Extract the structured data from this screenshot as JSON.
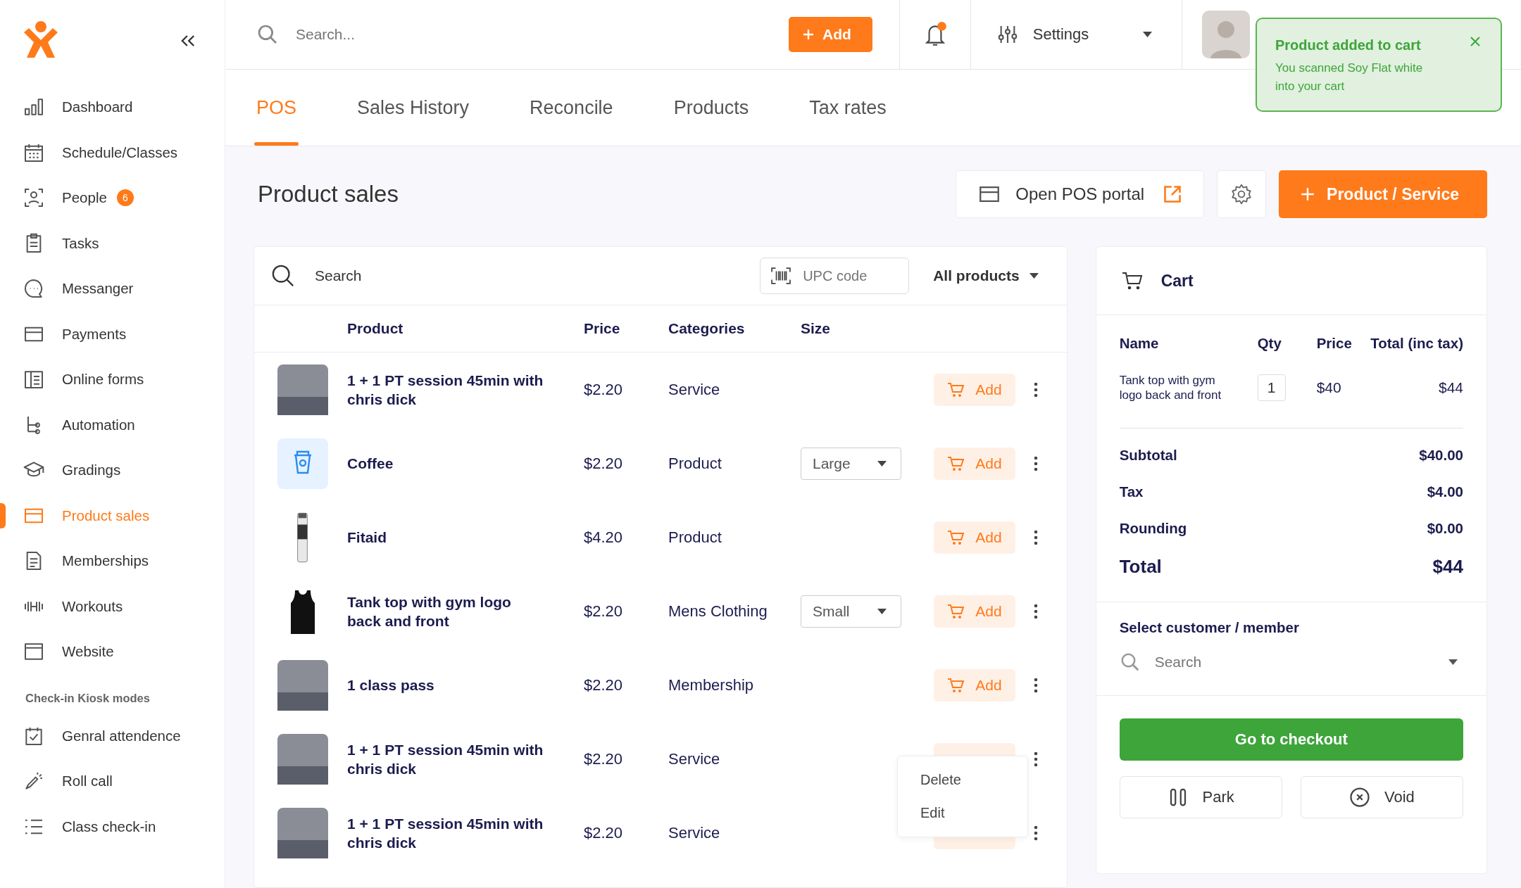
{
  "sidebar": {
    "items": [
      {
        "label": "Dashboard",
        "selected": false
      },
      {
        "label": "Schedule/Classes",
        "selected": false
      },
      {
        "label": "People",
        "badge": "6",
        "selected": false
      },
      {
        "label": "Tasks",
        "selected": false
      },
      {
        "label": "Messanger",
        "selected": false
      },
      {
        "label": "Payments",
        "selected": false
      },
      {
        "label": "Online forms",
        "selected": false
      },
      {
        "label": "Automation",
        "selected": false
      },
      {
        "label": "Gradings",
        "selected": false
      },
      {
        "label": "Product sales",
        "selected": true
      },
      {
        "label": "Memberships",
        "selected": false
      },
      {
        "label": "Workouts",
        "selected": false
      },
      {
        "label": "Website",
        "selected": false
      }
    ],
    "section_title": "Check-in Kiosk modes",
    "kiosk_items": [
      {
        "label": "Genral attendence",
        "selected": false
      },
      {
        "label": "Roll call",
        "selected": false
      },
      {
        "label": "Class check-in",
        "selected": false
      }
    ]
  },
  "header": {
    "search_placeholder": "Search...",
    "add_button": "Add",
    "settings": "Settings"
  },
  "toast": {
    "title": "Product added to cart",
    "message": "You scanned Soy Flat white into your cart"
  },
  "tabs": [
    {
      "label": "POS",
      "selected": true
    },
    {
      "label": "Sales History",
      "selected": false
    },
    {
      "label": "Reconcile",
      "selected": false
    },
    {
      "label": "Products",
      "selected": false
    },
    {
      "label": "Tax rates",
      "selected": false
    }
  ],
  "page": {
    "title": "Product sales",
    "portal_button": "Open POS portal",
    "primary_button": "Product / Service"
  },
  "products": {
    "search_placeholder": "Search",
    "upc_placeholder": "UPC code",
    "filter": "All products",
    "columns": [
      "Product",
      "Price",
      "Categories",
      "Size"
    ],
    "rows": [
      {
        "name": "1 + 1 PT session 45min with chris dick",
        "price": "$2.20",
        "category": "Service",
        "add": "Add"
      },
      {
        "name": "Coffee",
        "price": "$2.20",
        "category": "Product",
        "size": "Large",
        "add": "Add"
      },
      {
        "name": "Fitaid",
        "price": "$4.20",
        "category": "Product",
        "add": "Add"
      },
      {
        "name": "Tank top with gym logo back and front",
        "price": "$2.20",
        "category": "Mens Clothing",
        "size": "Small",
        "add": "Add"
      },
      {
        "name": "1 class pass",
        "price": "$2.20",
        "category": "Membership",
        "add": "Add"
      },
      {
        "name": "1 + 1 PT session 45min with chris dick",
        "price": "$2.20",
        "category": "Service"
      },
      {
        "name": "1 + 1 PT session 45min with chris dick",
        "price": "$2.20",
        "category": "Service"
      }
    ],
    "menu": [
      "Delete",
      "Edit"
    ]
  },
  "cart": {
    "title": "Cart",
    "columns": [
      "Name",
      "Qty",
      "Price",
      "Total (inc tax)"
    ],
    "items": [
      {
        "name": "Tank top with gym logo back and front",
        "qty": "1",
        "price": "$40",
        "total": "$44"
      }
    ],
    "summary": [
      {
        "label": "Subtotal",
        "value": "$40.00"
      },
      {
        "label": "Tax",
        "value": "$4.00"
      },
      {
        "label": "Rounding",
        "value": "$0.00"
      }
    ],
    "total": {
      "label": "Total",
      "value": "$44"
    },
    "customer_label": "Select customer / member",
    "customer_placeholder": "Search",
    "checkout": "Go to checkout",
    "park": "Park",
    "void": "Void"
  }
}
